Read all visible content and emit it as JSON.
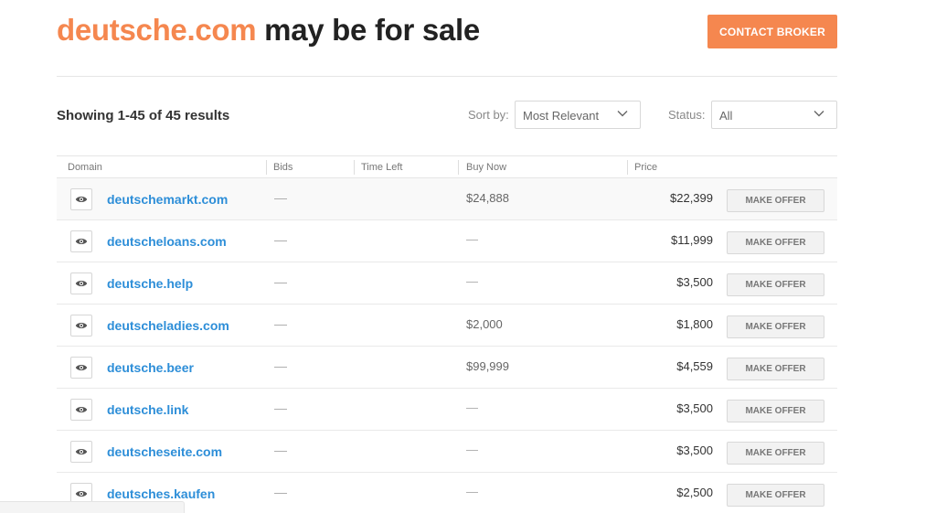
{
  "header": {
    "domain": "deutsche.com",
    "title_rest": " may be for sale",
    "contact_label": "CONTACT BROKER"
  },
  "results": {
    "showing_text": "Showing 1-45 of 45 results",
    "sort_label": "Sort by:",
    "sort_value": "Most Relevant",
    "status_label": "Status:",
    "status_value": "All"
  },
  "table": {
    "columns": [
      "Domain",
      "Bids",
      "Time Left",
      "Buy Now",
      "Price"
    ],
    "offer_label": "MAKE OFFER",
    "rows": [
      {
        "domain": "deutschemarkt.com",
        "bids": "—",
        "buy_now": "$24,888",
        "price": "$22,399"
      },
      {
        "domain": "deutscheloans.com",
        "bids": "—",
        "buy_now": "—",
        "price": "$11,999"
      },
      {
        "domain": "deutsche.help",
        "bids": "—",
        "buy_now": "—",
        "price": "$3,500"
      },
      {
        "domain": "deutscheladies.com",
        "bids": "—",
        "buy_now": "$2,000",
        "price": "$1,800"
      },
      {
        "domain": "deutsche.beer",
        "bids": "—",
        "buy_now": "$99,999",
        "price": "$4,559"
      },
      {
        "domain": "deutsche.link",
        "bids": "—",
        "buy_now": "—",
        "price": "$3,500"
      },
      {
        "domain": "deutscheseite.com",
        "bids": "—",
        "buy_now": "—",
        "price": "$3,500"
      },
      {
        "domain": "deutsches.kaufen",
        "bids": "—",
        "buy_now": "—",
        "price": "$2,500"
      }
    ]
  },
  "colors": {
    "accent": "#f5874f",
    "link": "#2d8ed8"
  },
  "icons": {
    "preview": "eye-icon",
    "dropdown": "chevron-down-icon"
  }
}
